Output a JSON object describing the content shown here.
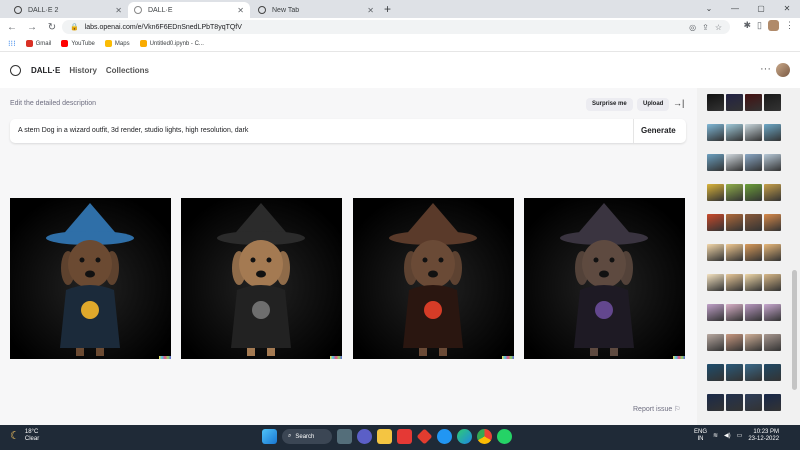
{
  "browser": {
    "tabs": [
      {
        "title": "DALL·E 2",
        "active": false
      },
      {
        "title": "DALL·E",
        "active": true
      },
      {
        "title": "New Tab",
        "active": false
      }
    ],
    "url": "labs.openai.com/e/Vkn6F6EDnSnedLPbT8yqTQfV",
    "bookmarks": [
      {
        "label": "Gmail",
        "icon": "gmail-icon",
        "color": "#d93025"
      },
      {
        "label": "YouTube",
        "icon": "youtube-icon",
        "color": "#ff0000"
      },
      {
        "label": "Maps",
        "icon": "maps-icon",
        "color": "#fbbc04"
      },
      {
        "label": "Untitled0.ipynb - C...",
        "icon": "colab-icon",
        "color": "#f9ab00"
      }
    ]
  },
  "app": {
    "brand": "DALL·E",
    "nav": [
      "History",
      "Collections"
    ],
    "more": "···"
  },
  "editor": {
    "label": "Edit the detailed description",
    "surprise": "Surprise me",
    "upload": "Upload",
    "prompt": "A stern Dog in a wizard outfit, 3d render, studio lights, high resolution, dark",
    "generate": "Generate"
  },
  "results": [
    {
      "name": "result-image-1",
      "hat": "#2f6fa8",
      "fur": "#6b4a32",
      "accent": "#f5b62a",
      "robe": "#1b2a3a"
    },
    {
      "name": "result-image-2",
      "hat": "#2b2b2b",
      "fur": "#a47a52",
      "accent": "#777777",
      "robe": "#222222"
    },
    {
      "name": "result-image-3",
      "hat": "#5a3a2a",
      "fur": "#6a4a36",
      "accent": "#e8402a",
      "robe": "#2a1610"
    },
    {
      "name": "result-image-4",
      "hat": "#3a3440",
      "fur": "#5e4a40",
      "accent": "#6a4c9a",
      "robe": "#1e1a24"
    }
  ],
  "report": "Report issue",
  "history_colors": [
    [
      "#111111",
      "#222244",
      "#441111",
      "#1a1a1a"
    ],
    [
      "#7fb7d6",
      "#9fc9d9",
      "#c8d6dc",
      "#6da8c7"
    ],
    [
      "#6b9fbf",
      "#d0d8de",
      "#8aa7c5",
      "#b7c9d8"
    ],
    [
      "#d9b33a",
      "#8fae4a",
      "#6c9f3a",
      "#c7a04a"
    ],
    [
      "#c94a2a",
      "#b06a3a",
      "#8a5a3a",
      "#d88a4a"
    ],
    [
      "#f2d6a8",
      "#f0c890",
      "#d89a5a",
      "#e8b87a"
    ],
    [
      "#f4e2c0",
      "#e8c898",
      "#f0d8a8",
      "#d8b888"
    ],
    [
      "#c0a0c8",
      "#d8b0c8",
      "#b898c0",
      "#c8a8d0"
    ],
    [
      "#b8a8a0",
      "#c89880",
      "#d0b098",
      "#a89890"
    ],
    [
      "#1e4e6e",
      "#2a5a7a",
      "#3a6a8a",
      "#204a66"
    ],
    [
      "#1a2a4a",
      "#22324e",
      "#2e3e5a",
      "#18284a"
    ]
  ],
  "taskbar": {
    "temp": "18°C",
    "condition": "Clear",
    "search": "Search",
    "lang1": "ENG",
    "lang2": "IN",
    "time": "10:23 PM",
    "date": "23-12-2022"
  }
}
